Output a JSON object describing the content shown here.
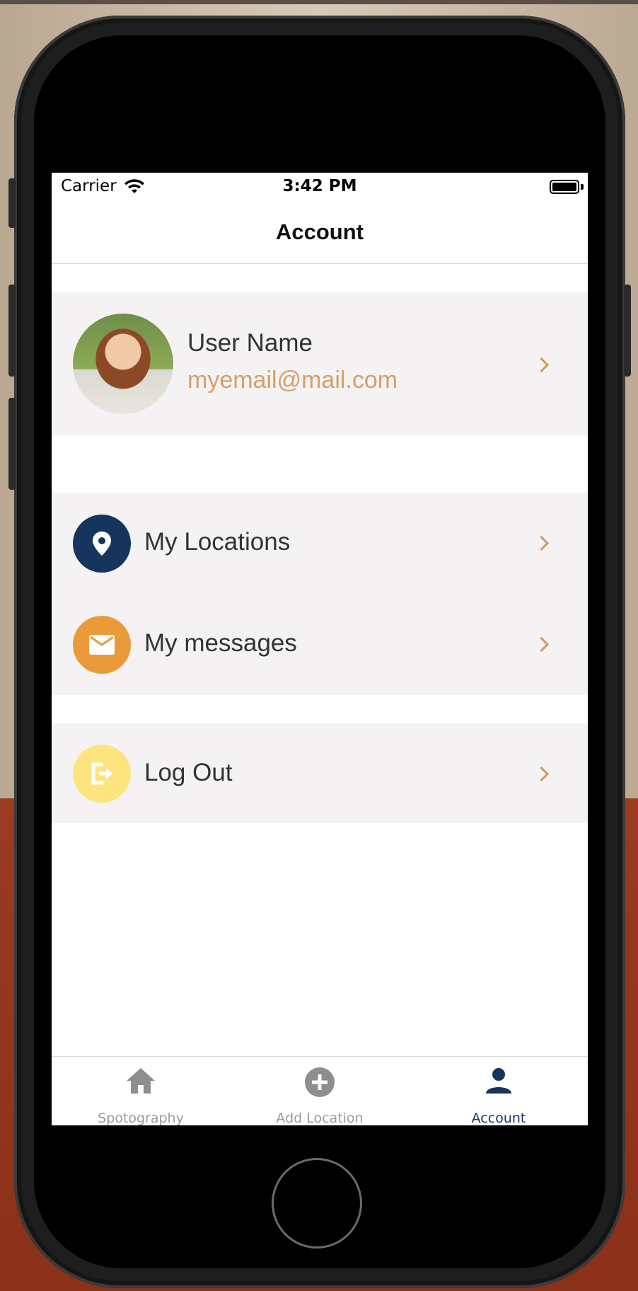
{
  "status_bar": {
    "carrier": "Carrier",
    "time": "3:42 PM"
  },
  "nav": {
    "title": "Account"
  },
  "profile": {
    "name": "User Name",
    "email": "myemail@mail.com"
  },
  "menu": {
    "items": [
      {
        "label": "My Locations",
        "icon": "location-pin-icon",
        "color": "#15355f"
      },
      {
        "label": "My messages",
        "icon": "mail-icon",
        "color": "#eb9a3a"
      }
    ],
    "logout": {
      "label": "Log Out",
      "icon": "logout-icon",
      "color": "#fde47f"
    }
  },
  "tabbar": {
    "tabs": [
      {
        "label": "Spotography",
        "icon": "home-icon",
        "active": false
      },
      {
        "label": "Add Location",
        "icon": "add-circle-icon",
        "active": false
      },
      {
        "label": "Account",
        "icon": "person-icon",
        "active": true
      }
    ]
  },
  "colors": {
    "accent": "#d4a06a",
    "navy": "#15355f",
    "row_background": "#f4f2f3"
  }
}
